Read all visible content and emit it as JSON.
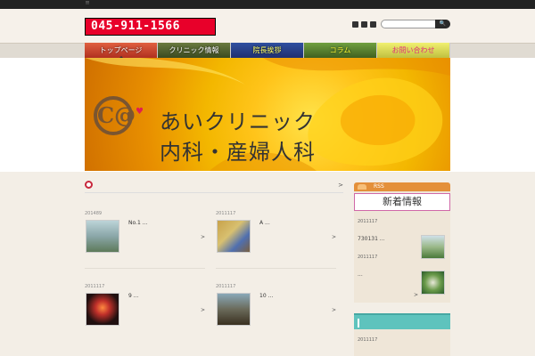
{
  "topbar": {
    "text": "!!"
  },
  "header": {
    "phone": "045-911-1566",
    "search_button": "🔍"
  },
  "nav": [
    {
      "label": "トップページ"
    },
    {
      "label": "クリニック情報"
    },
    {
      "label": "院長挨拶"
    },
    {
      "label": "コラム"
    },
    {
      "label": "お問い合わせ"
    }
  ],
  "hero": {
    "logo": "C@",
    "line1": "あいクリニック",
    "line2": "内科・産婦人科"
  },
  "section": {
    "arrow": ">"
  },
  "posts": [
    {
      "date": "201489",
      "title": "No.1 ...",
      "arrow": ">"
    },
    {
      "date": "2011117",
      "title": "A ...",
      "arrow": ">"
    },
    {
      "date": "2011117",
      "title": "9 ...",
      "arrow": ">"
    },
    {
      "date": "2011117",
      "title": "10 ...",
      "arrow": ">"
    }
  ],
  "sidebar": {
    "rss": "RSS",
    "news_heading": "新着情報",
    "news": [
      {
        "date": "2011117",
        "text": "730131 ..."
      },
      {
        "date": "2011117",
        "text": "..."
      }
    ],
    "news_arrow": ">",
    "teal_date": "2011117"
  },
  "colors": {
    "accent": "#c8283c",
    "rss": "#e4903a",
    "teal": "#5ec3bd",
    "phone_bg": "#e8002a"
  }
}
